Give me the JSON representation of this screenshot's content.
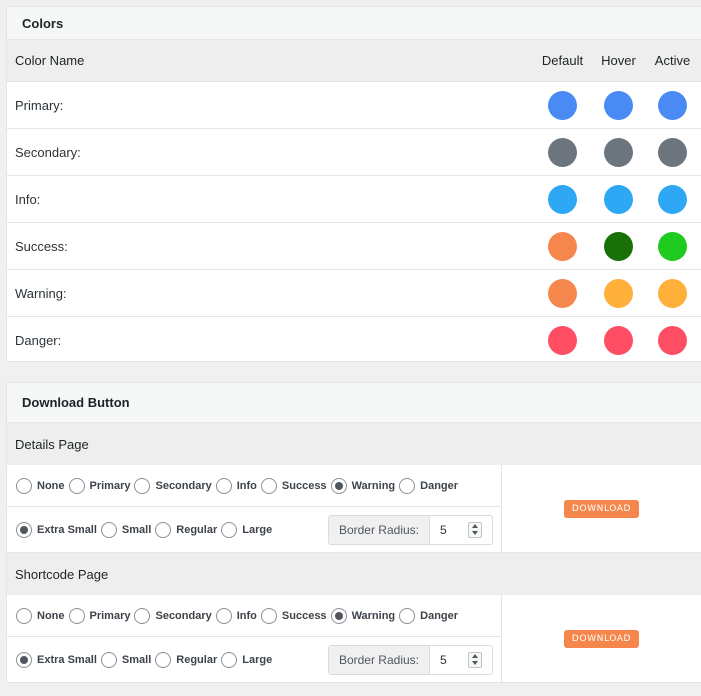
{
  "colors": {
    "title": "Colors",
    "headers": {
      "name": "Color Name",
      "default": "Default",
      "hover": "Hover",
      "active": "Active"
    },
    "rows": [
      {
        "label": "Primary:",
        "default": "#4a8af4",
        "hover": "#4a8af4",
        "active": "#4a8af4"
      },
      {
        "label": "Secondary:",
        "default": "#6c757d",
        "hover": "#6c757d",
        "active": "#6c757d"
      },
      {
        "label": "Info:",
        "default": "#2ea8f5",
        "hover": "#2ea8f5",
        "active": "#2ea8f5"
      },
      {
        "label": "Success:",
        "default": "#f5874c",
        "hover": "#187007",
        "active": "#1fcb1f"
      },
      {
        "label": "Warning:",
        "default": "#f5874c",
        "hover": "#ffb03b",
        "active": "#ffb03b"
      },
      {
        "label": "Danger:",
        "default": "#ff4d63",
        "hover": "#ff4d63",
        "active": "#ff4d63"
      }
    ]
  },
  "download": {
    "title": "Download Button",
    "sections": [
      {
        "title": "Details Page",
        "styles": [
          "None",
          "Primary",
          "Secondary",
          "Info",
          "Success",
          "Warning",
          "Danger"
        ],
        "style_selected": "Warning",
        "sizes": [
          "Extra Small",
          "Small",
          "Regular",
          "Large"
        ],
        "size_selected": "Extra Small",
        "radius_label": "Border Radius:",
        "radius_value": "5",
        "button_label": "DOWNLOAD"
      },
      {
        "title": "Shortcode Page",
        "styles": [
          "None",
          "Primary",
          "Secondary",
          "Info",
          "Success",
          "Warning",
          "Danger"
        ],
        "style_selected": "Warning",
        "sizes": [
          "Extra Small",
          "Small",
          "Regular",
          "Large"
        ],
        "size_selected": "Extra Small",
        "radius_label": "Border Radius:",
        "radius_value": "5",
        "button_label": "DOWNLOAD"
      }
    ]
  }
}
